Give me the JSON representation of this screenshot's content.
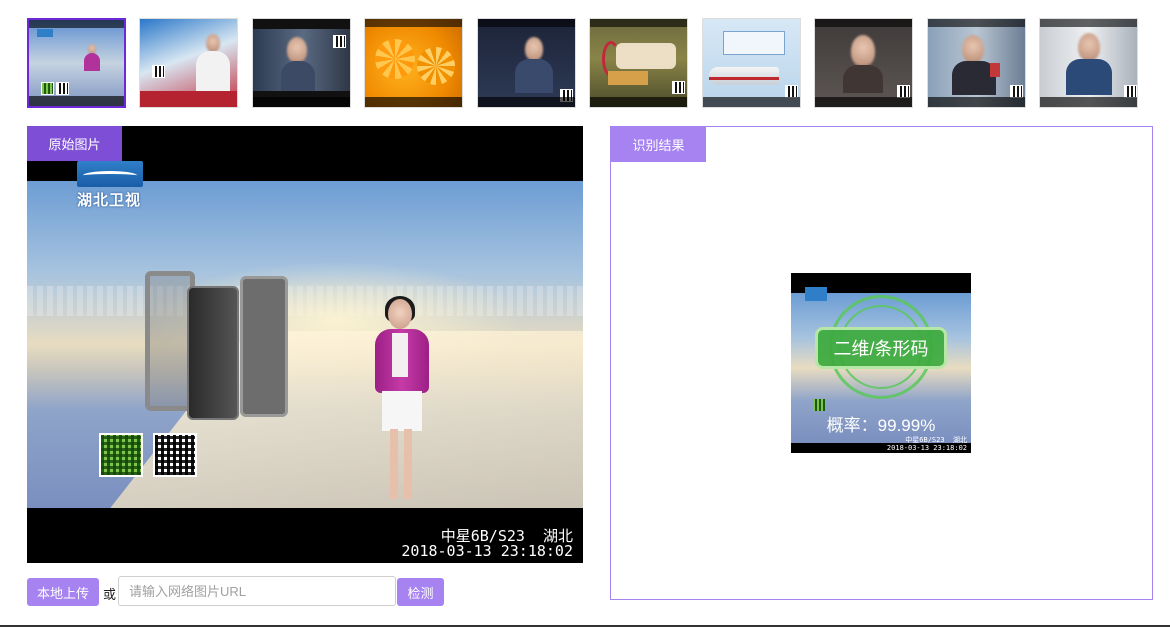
{
  "left_panel": {
    "tag": "原始图片",
    "logo_text": "湖北卫视",
    "overlay_line1": "中星6B/S23  湖北",
    "overlay_line2": "2018-03-13 23:18:02"
  },
  "right_panel": {
    "tag": "识别结果",
    "detection_label": "二维/条形码",
    "probability": "概率：99.99%",
    "footer_line1": "中星6B/S23  湖北",
    "footer_line2": "2018-03-13 23:18:02"
  },
  "controls": {
    "upload_label": "本地上传",
    "or_label": "或",
    "url_placeholder": "请输入网络图片URL",
    "detect_label": "检测"
  },
  "thumbnails": [
    {
      "selected": true
    },
    {
      "selected": false
    },
    {
      "selected": false
    },
    {
      "selected": false
    },
    {
      "selected": false
    },
    {
      "selected": false
    },
    {
      "selected": false
    },
    {
      "selected": false
    },
    {
      "selected": false
    },
    {
      "selected": false
    }
  ],
  "colors": {
    "accent": "#7e4fd6",
    "accent_light": "#a783f2",
    "selected_border": "#6d28d9"
  }
}
